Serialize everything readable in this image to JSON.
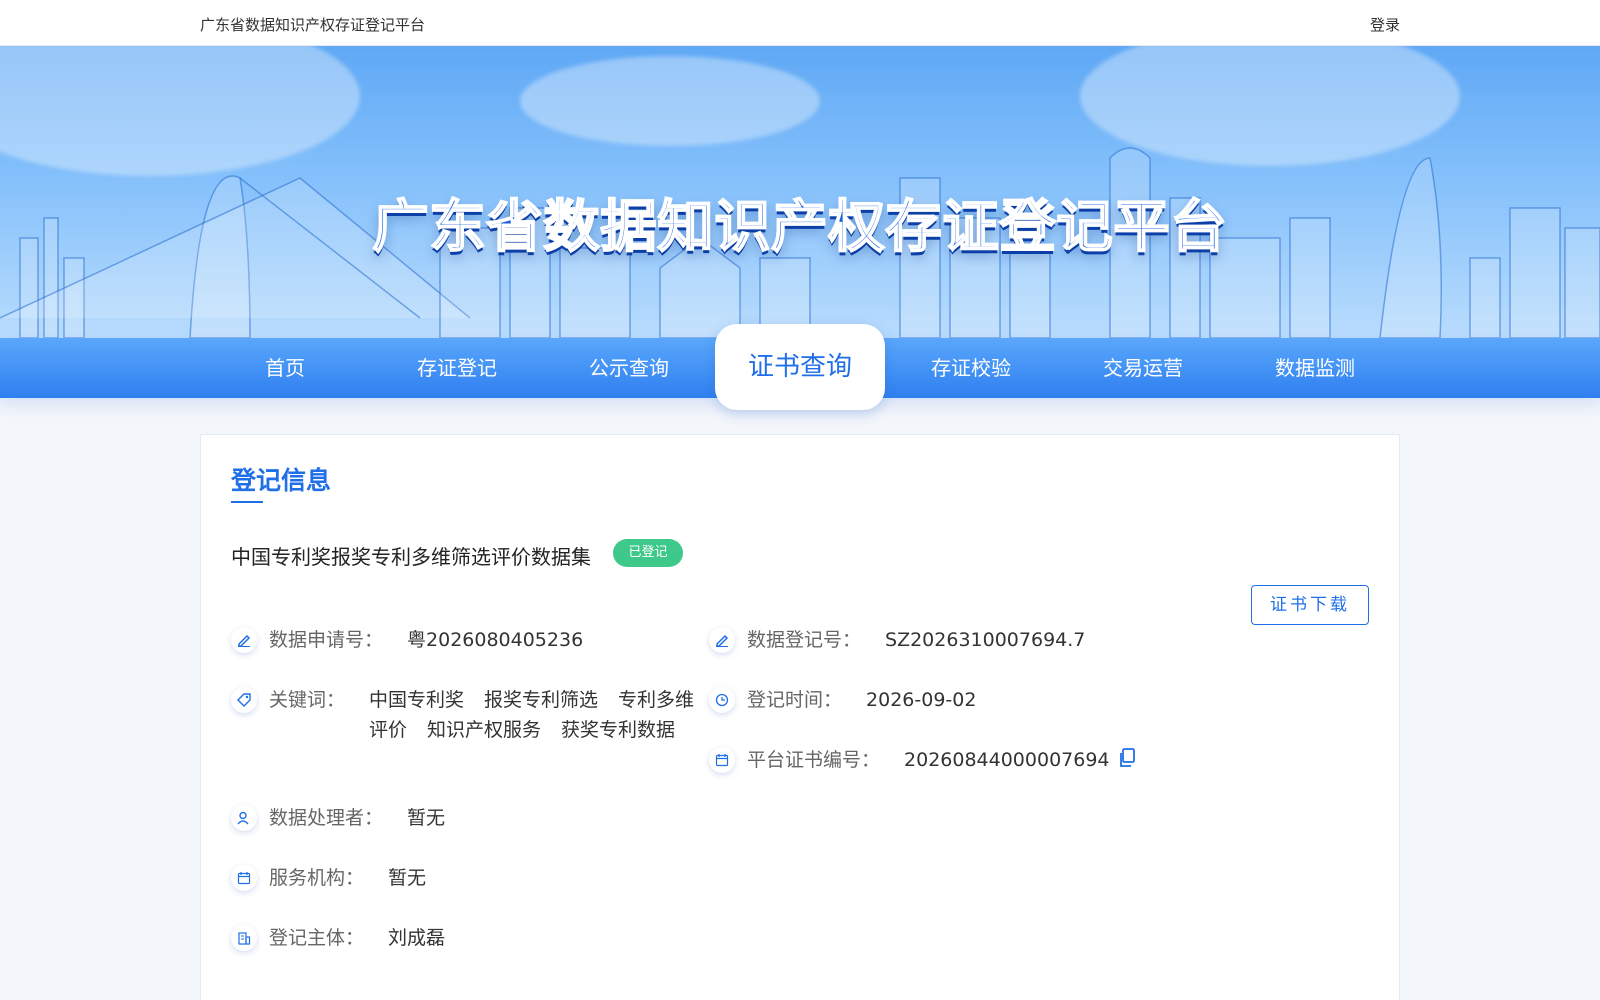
{
  "topbar": {
    "site_name": "广东省数据知识产权存证登记平台",
    "login": "登录"
  },
  "banner": {
    "title": "广东省数据知识产权存证登记平台"
  },
  "nav": {
    "items": [
      {
        "label": "首页"
      },
      {
        "label": "存证登记"
      },
      {
        "label": "公示查询"
      },
      {
        "label": "证书查询"
      },
      {
        "label": "存证校验"
      },
      {
        "label": "交易运营"
      },
      {
        "label": "数据监测"
      }
    ],
    "active": "证书查询"
  },
  "record": {
    "section_title": "登记信息",
    "dataset_name": "中国专利奖报奖专利多维筛选评价数据集",
    "status": "已登记",
    "download_label": "证书下载",
    "fields": {
      "application_no": {
        "label": "数据申请号：",
        "value": "粤2026080405236"
      },
      "registration_no": {
        "label": "数据登记号：",
        "value": "SZ2026310007694.7"
      },
      "keywords": {
        "label": "关键词：",
        "values": [
          "中国专利奖",
          "报奖专利筛选",
          "专利多维评价",
          "知识产权服务",
          "获奖专利数据"
        ]
      },
      "registration_time": {
        "label": "登记时间：",
        "value": "2026-09-02"
      },
      "certificate_no": {
        "label": "平台证书编号：",
        "value": "20260844000007694"
      },
      "processor": {
        "label": "数据处理者：",
        "value": "暂无"
      },
      "service_agency": {
        "label": "服务机构：",
        "value": "暂无"
      },
      "registrant": {
        "label": "登记主体：",
        "value": "刘成磊"
      }
    }
  },
  "colors": {
    "primary": "#1f6fe8",
    "status_green": "#3ec98a",
    "nav_top": "#5aa7fb",
    "nav_bottom": "#2f7ff0"
  }
}
